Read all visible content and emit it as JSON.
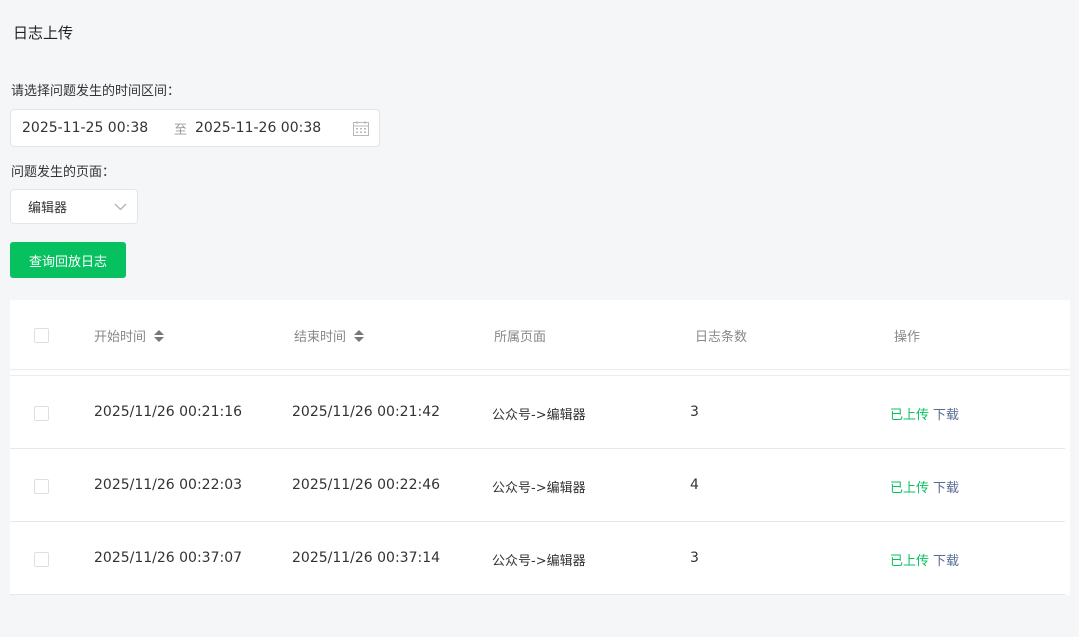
{
  "page": {
    "title": "日志上传"
  },
  "form": {
    "time_label": "请选择问题发生的时间区间：",
    "start_time": "2025-11-25 00:38",
    "separator": "至",
    "end_time": "2025-11-26 00:38",
    "page_label": "问题发生的页面：",
    "page_select_value": "编辑器",
    "query_button": "查询回放日志"
  },
  "table": {
    "headers": {
      "start": "开始时间",
      "end": "结束时间",
      "page": "所属页面",
      "count": "日志条数",
      "action": "操作"
    },
    "rows": [
      {
        "start": "2025/11/26 00:21:16",
        "end": "2025/11/26 00:21:42",
        "page": "公众号->编辑器",
        "count": "3",
        "status": "已上传",
        "download": "下载"
      },
      {
        "start": "2025/11/26 00:22:03",
        "end": "2025/11/26 00:22:46",
        "page": "公众号->编辑器",
        "count": "4",
        "status": "已上传",
        "download": "下载"
      },
      {
        "start": "2025/11/26 00:37:07",
        "end": "2025/11/26 00:37:14",
        "page": "公众号->编辑器",
        "count": "3",
        "status": "已上传",
        "download": "下载"
      }
    ]
  },
  "colors": {
    "accent": "#07c160",
    "link": "#576b95"
  },
  "icons": {
    "calendar": "calendar-icon",
    "chevron": "chevron-down-icon",
    "sort": "sort-icon"
  }
}
